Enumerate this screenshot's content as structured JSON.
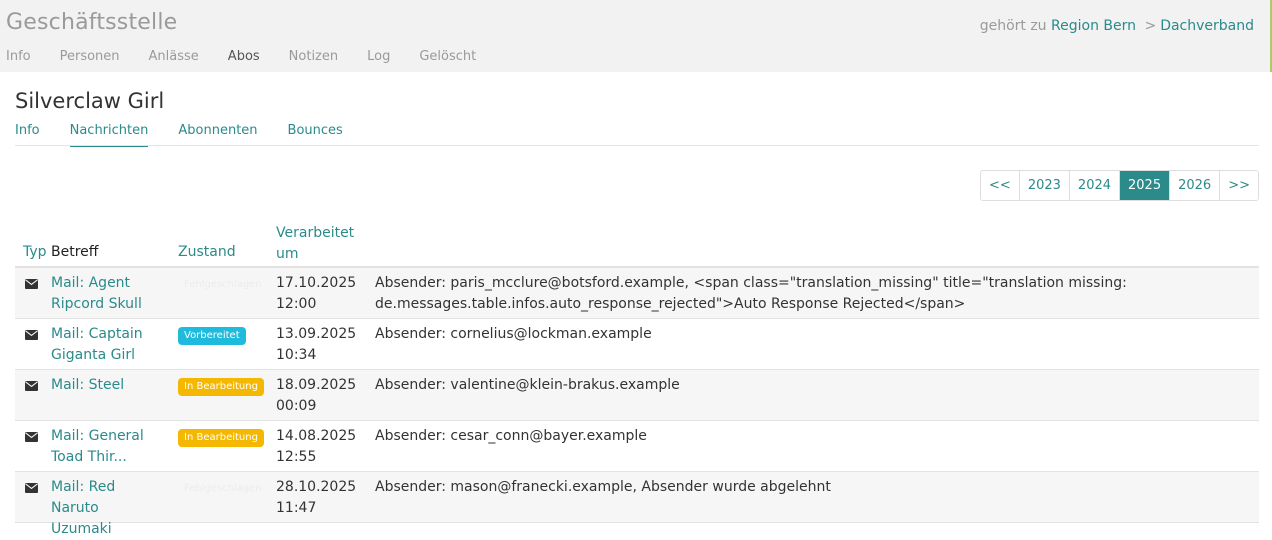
{
  "header": {
    "group_title": "Geschäftsstelle",
    "belongs_to_label": "gehört zu",
    "breadcrumb": [
      "Region Bern",
      "Dachverband"
    ],
    "breadcrumb_separator": ">",
    "tabs": [
      {
        "label": "Info",
        "active": false
      },
      {
        "label": "Personen",
        "active": false
      },
      {
        "label": "Anlässe",
        "active": false
      },
      {
        "label": "Abos",
        "active": true
      },
      {
        "label": "Notizen",
        "active": false
      },
      {
        "label": "Log",
        "active": false
      },
      {
        "label": "Gelöscht",
        "active": false
      }
    ]
  },
  "page": {
    "title": "Silverclaw Girl",
    "tabs": [
      {
        "label": "Info",
        "active": false
      },
      {
        "label": "Nachrichten",
        "active": true
      },
      {
        "label": "Abonnenten",
        "active": false
      },
      {
        "label": "Bounces",
        "active": false
      }
    ]
  },
  "pager": {
    "prev": "<<",
    "years": [
      "2023",
      "2024",
      "2025",
      "2026"
    ],
    "active_year": "2025",
    "next": ">>"
  },
  "table": {
    "columns": {
      "type": "Typ",
      "subject": "Betreff",
      "state": "Zustand",
      "processed_line1": "Verarbeitet",
      "processed_line2": "um"
    },
    "rows": [
      {
        "type_icon": "envelope-icon",
        "subject": "Mail: Agent Ripcord Skull",
        "state": "Fehlgeschlagen",
        "state_kind": "failed",
        "date": "17.10.2025",
        "time": "12:00",
        "info": "Absender: paris_mcclure@botsford.example, <span class=\"translation_missing\" title=\"translation missing: de.messages.table.infos.auto_response_rejected\">Auto Response Rejected</span>"
      },
      {
        "type_icon": "envelope-icon",
        "subject": "Mail: Captain Giganta Girl",
        "state": "Vorbereitet",
        "state_kind": "prepared",
        "date": "13.09.2025",
        "time": "10:34",
        "info": "Absender: cornelius@lockman.example"
      },
      {
        "type_icon": "envelope-icon",
        "subject": "Mail: Steel",
        "state": "In Bearbeitung",
        "state_kind": "processing",
        "date": "18.09.2025",
        "time": "00:09",
        "info": "Absender: valentine@klein-brakus.example"
      },
      {
        "type_icon": "envelope-icon",
        "subject": "Mail: General Toad Thir...",
        "state": "In Bearbeitung",
        "state_kind": "processing",
        "date": "14.08.2025",
        "time": "12:55",
        "info": "Absender: cesar_conn@bayer.example"
      },
      {
        "type_icon": "envelope-icon",
        "subject": "Mail: Red Naruto Uzumaki",
        "state": "Fehlgeschlagen",
        "state_kind": "failed",
        "date": "28.10.2025",
        "time": "11:47",
        "info": "Absender: mason@franecki.example, Absender wurde abgelehnt"
      }
    ]
  },
  "colors": {
    "accent": "#2b8a8a",
    "prepared": "#1fbbdd",
    "processing": "#f5b800",
    "topbar_edge": "#a8cc6a"
  }
}
